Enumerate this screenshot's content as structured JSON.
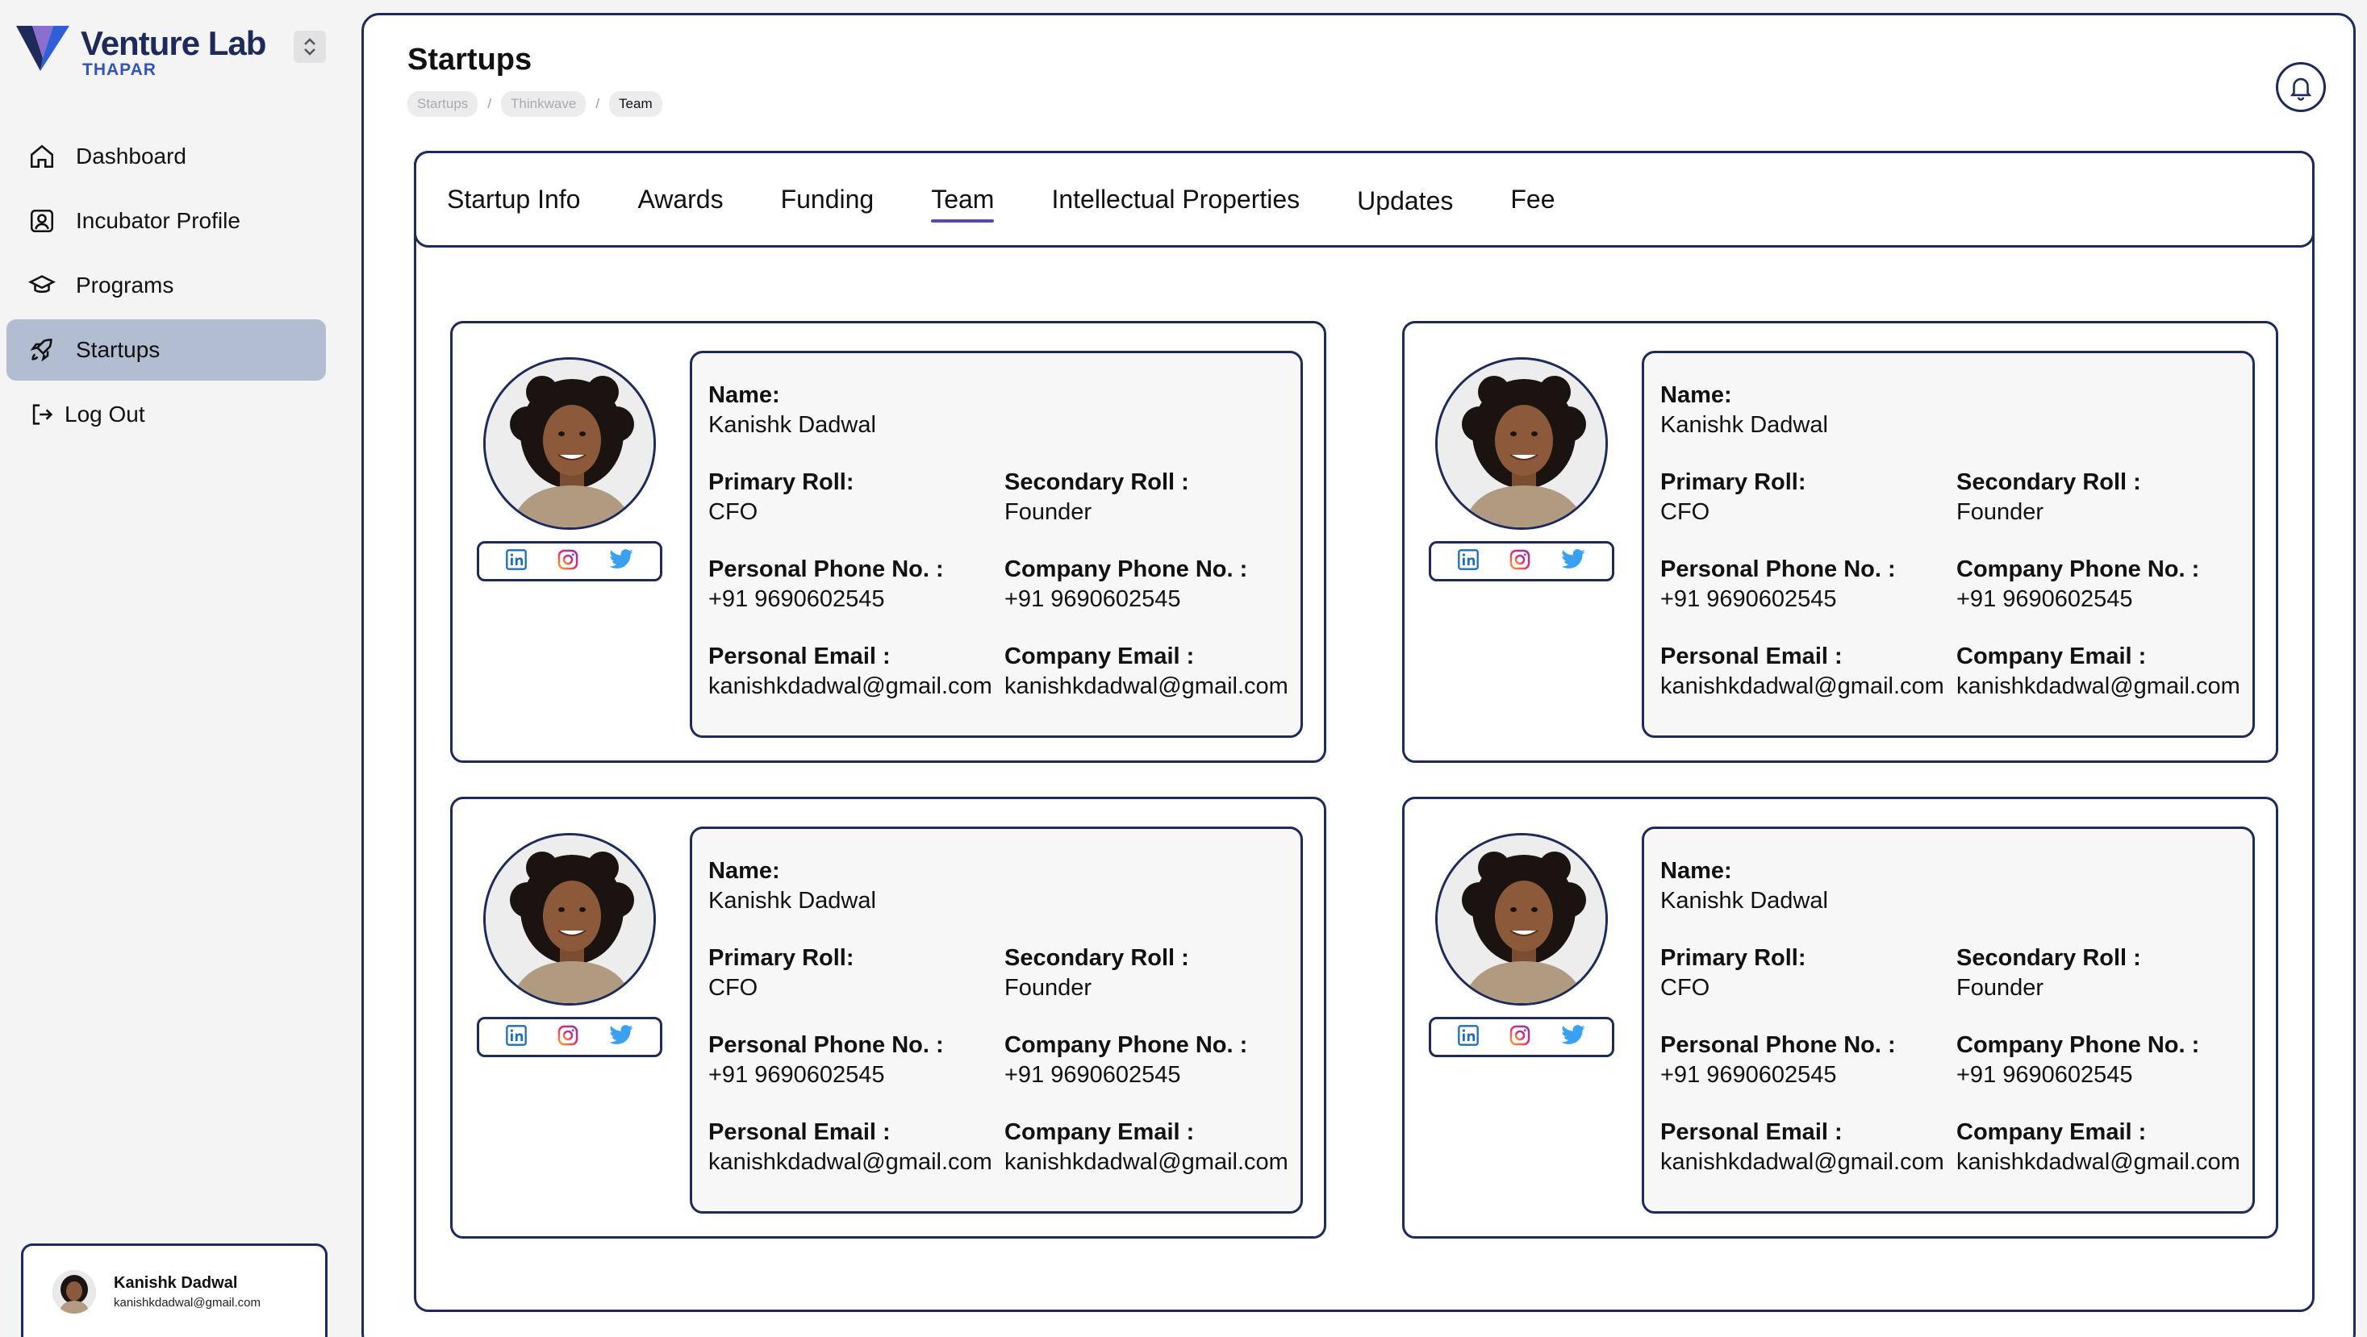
{
  "brand": {
    "title": "Venture Lab",
    "subtitle": "THAPAR",
    "accent": "#1e2a5a"
  },
  "sidebar": {
    "items": [
      {
        "label": "Dashboard",
        "icon": "home-icon",
        "active": false
      },
      {
        "label": "Incubator  Profile",
        "icon": "profile-icon",
        "active": false
      },
      {
        "label": "Programs",
        "icon": "graduation-cap-icon",
        "active": false
      },
      {
        "label": "Startups",
        "icon": "rocket-icon",
        "active": true
      },
      {
        "label": "Log Out",
        "icon": "logout-icon",
        "active": false
      }
    ],
    "user": {
      "name": "Kanishk Dadwal",
      "email": "kanishkdadwal@gmail.com"
    }
  },
  "header": {
    "title": "Startups",
    "breadcrumb": [
      "Startups",
      "Thinkwave",
      "Team"
    ]
  },
  "tabs": [
    "Startup Info",
    "Awards",
    "Funding",
    "Team",
    "Intellectual Properties",
    "Updates",
    "Fee"
  ],
  "active_tab": "Team",
  "labels": {
    "name": "Name:",
    "primary_roll": "Primary Roll:",
    "secondary_roll": "Secondary Roll :",
    "personal_phone": "Personal Phone No. :",
    "company_phone": "Company Phone No. :",
    "personal_email": "Personal Email :",
    "company_email": "Company Email :"
  },
  "members": [
    {
      "name": "Kanishk Dadwal",
      "primary_roll": "CFO",
      "secondary_roll": "Founder",
      "personal_phone": "+91 9690602545",
      "company_phone": "+91 9690602545",
      "personal_email": "kanishkdadwal@gmail.com",
      "company_email": "kanishkdadwal@gmail.com"
    },
    {
      "name": "Kanishk Dadwal",
      "primary_roll": "CFO",
      "secondary_roll": "Founder",
      "personal_phone": "+91 9690602545",
      "company_phone": "+91 9690602545",
      "personal_email": "kanishkdadwal@gmail.com",
      "company_email": "kanishkdadwal@gmail.com"
    },
    {
      "name": "Kanishk Dadwal",
      "primary_roll": "CFO",
      "secondary_roll": "Founder",
      "personal_phone": "+91 9690602545",
      "company_phone": "+91 9690602545",
      "personal_email": "kanishkdadwal@gmail.com",
      "company_email": "kanishkdadwal@gmail.com"
    },
    {
      "name": "Kanishk Dadwal",
      "primary_roll": "CFO",
      "secondary_roll": "Founder",
      "personal_phone": "+91 9690602545",
      "company_phone": "+91 9690602545",
      "personal_email": "kanishkdadwal@gmail.com",
      "company_email": "kanishkdadwal@gmail.com"
    }
  ],
  "social_icons": [
    "linkedin-icon",
    "instagram-icon",
    "twitter-icon"
  ]
}
